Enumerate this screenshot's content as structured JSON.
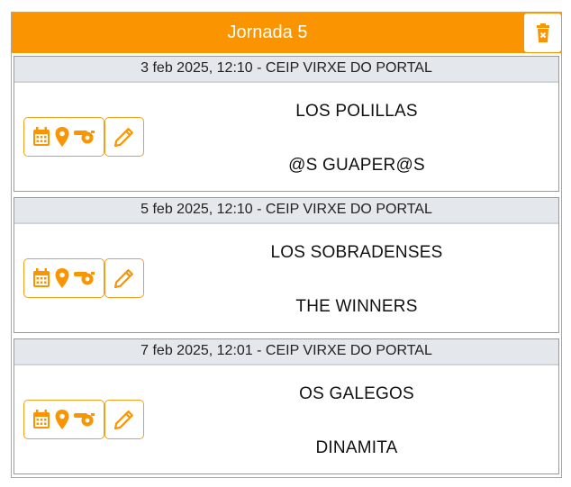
{
  "header": {
    "title": "Jornada 5"
  },
  "colors": {
    "accent": "#fa9400",
    "info_bg": "#e4e7eb"
  },
  "icons": {
    "delete": "trash-icon",
    "date": "calendar-icon",
    "location": "map-pin-icon",
    "referee": "whistle-icon",
    "edit": "pencil-icon"
  },
  "matches": [
    {
      "info": "3 feb 2025, 12:10 - CEIP VIRXE DO PORTAL",
      "home": "LOS POLILLAS",
      "away": "@S GUAPER@S"
    },
    {
      "info": "5 feb 2025, 12:10 - CEIP VIRXE DO PORTAL",
      "home": "LOS SOBRADENSES",
      "away": "THE WINNERS"
    },
    {
      "info": "7 feb 2025, 12:01 - CEIP VIRXE DO PORTAL",
      "home": "OS GALEGOS",
      "away": "DINAMITA"
    }
  ]
}
